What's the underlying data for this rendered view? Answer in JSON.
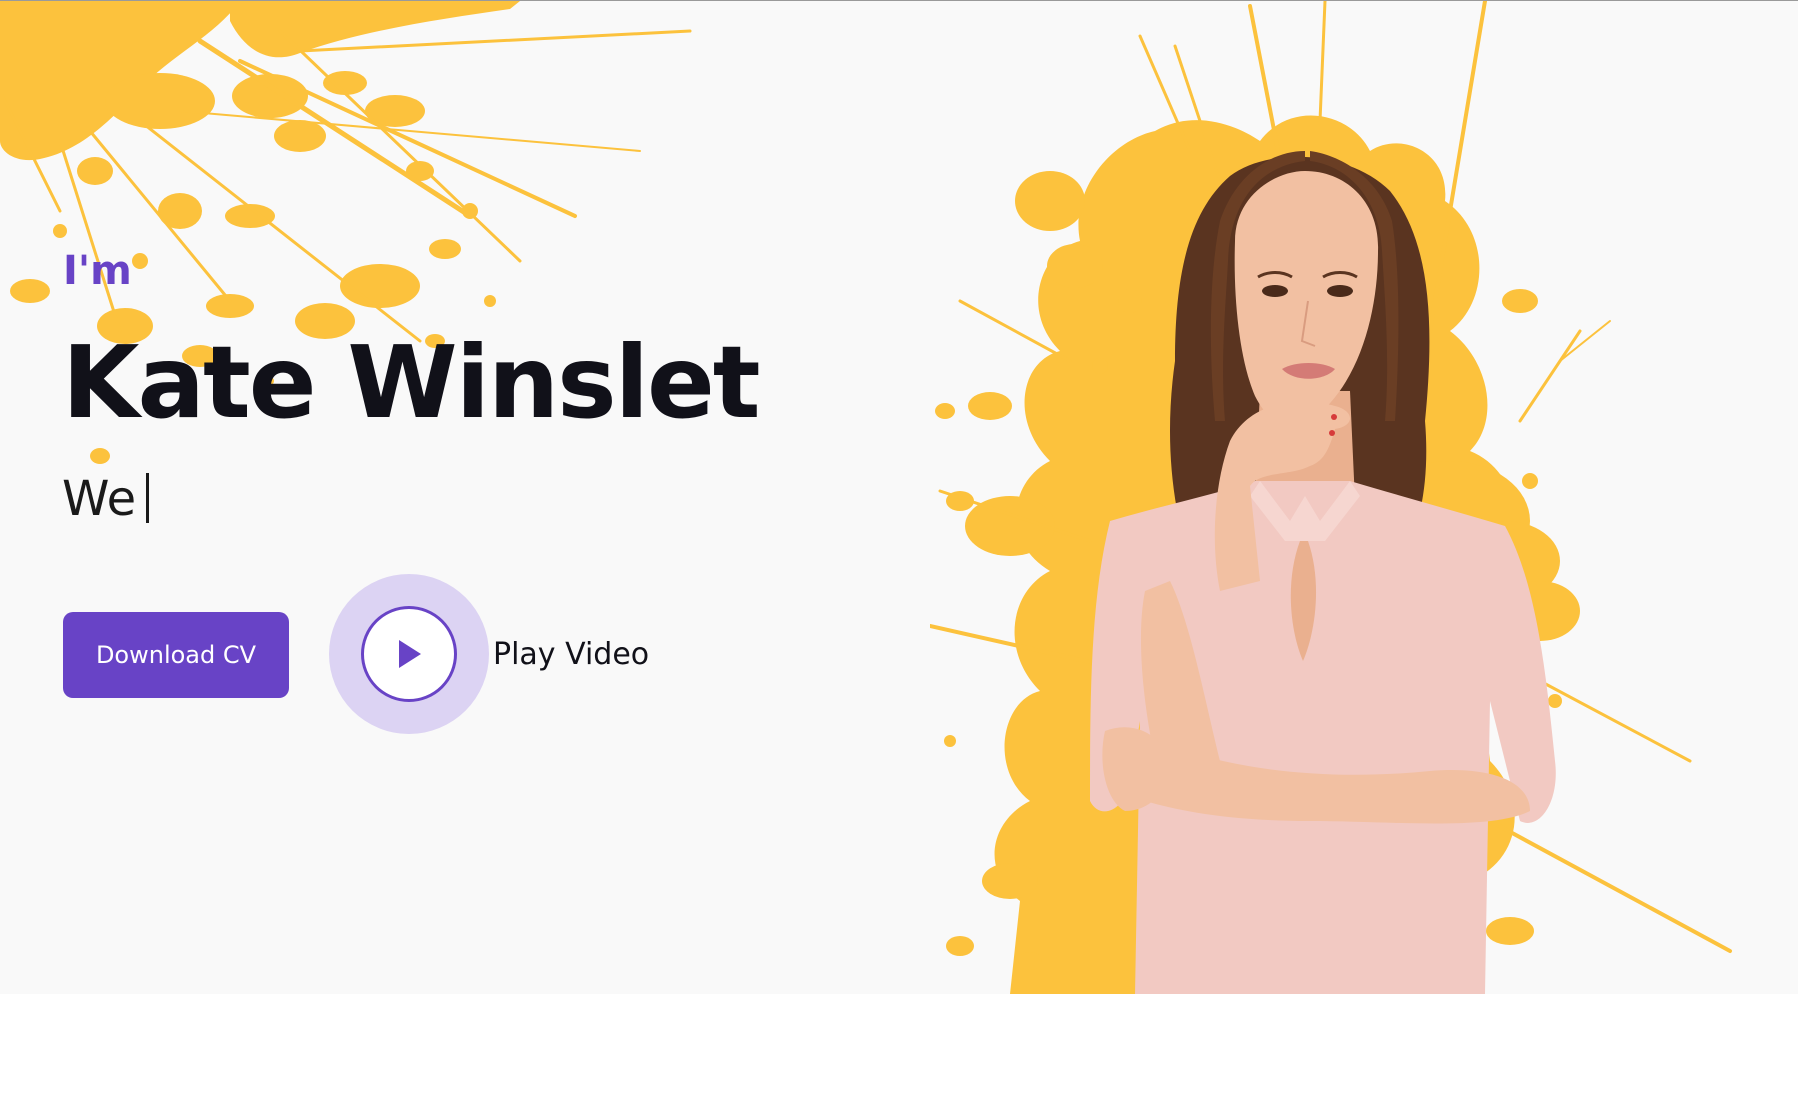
{
  "hero": {
    "intro": "I'm",
    "name": "Kate Winslet",
    "typed_text": "We",
    "download_label": "Download CV",
    "play_label": "Play Video"
  },
  "colors": {
    "accent": "#6843c6",
    "accent_soft": "#dcd3f3",
    "splash": "#fcc23d",
    "heading": "#111119",
    "background": "#f9f9f9",
    "dress": "#f2c9c2",
    "hair": "#5a3420",
    "skin": "#f2c0a2"
  },
  "icons": {
    "play": "play-icon",
    "decor": "paint-splash"
  }
}
